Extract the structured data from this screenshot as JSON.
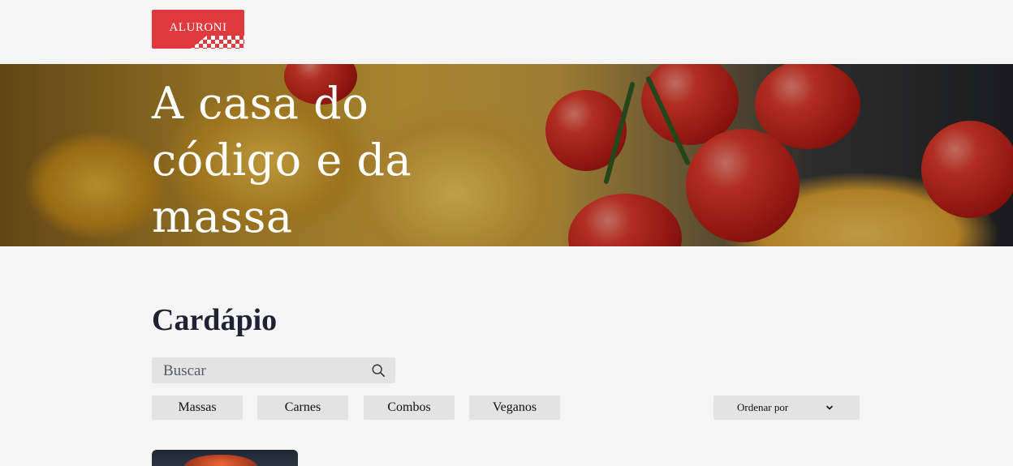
{
  "header": {
    "logo_text": "ALURONI"
  },
  "hero": {
    "title": "A casa do código e da massa"
  },
  "menu": {
    "title": "Cardápio",
    "search": {
      "placeholder": "Buscar",
      "value": ""
    },
    "filters": [
      "Massas",
      "Carnes",
      "Combos",
      "Veganos"
    ],
    "sort": {
      "label": "Ordenar por"
    }
  },
  "colors": {
    "brand": "#e0393e",
    "background": "#f5f5f5",
    "control": "#e3e3e3",
    "heading": "#1f2233"
  },
  "icons": {
    "search": "search-icon",
    "sort": "chevron-down-icon"
  }
}
